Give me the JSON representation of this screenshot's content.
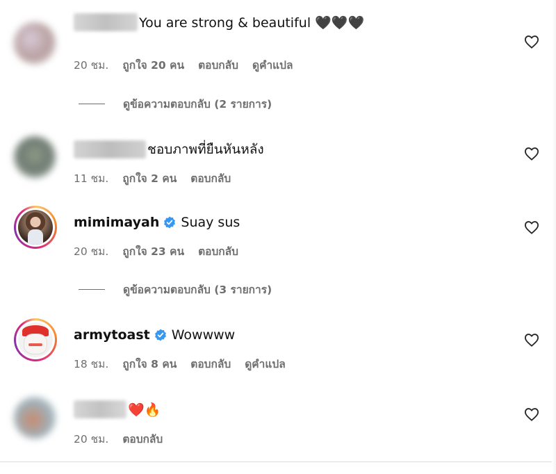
{
  "comments": [
    {
      "username": "",
      "text": "You are strong & beautiful 🖤🖤🖤",
      "time": "20 ชม.",
      "likes": "ถูกใจ 20 คน",
      "reply_label": "ตอบกลับ",
      "translate_label": "ดูคำแปล",
      "view_replies": "ดูข้อความตอบกลับ (2 รายการ)"
    },
    {
      "username": "",
      "text": "ชอบภาพที่ยืนหันหลัง",
      "time": "11 ชม.",
      "likes": "ถูกใจ 2 คน",
      "reply_label": "ตอบกลับ"
    },
    {
      "username": "mimimayah",
      "verified": true,
      "text": "Suay sus",
      "time": "20 ชม.",
      "likes": "ถูกใจ 23 คน",
      "reply_label": "ตอบกลับ",
      "view_replies": "ดูข้อความตอบกลับ (3 รายการ)"
    },
    {
      "username": "armytoast",
      "verified": true,
      "text": "Wowwww",
      "time": "18 ชม.",
      "likes": "ถูกใจ 8 คน",
      "reply_label": "ตอบกลับ",
      "translate_label": "ดูคำแปล"
    },
    {
      "username": "",
      "text": "❤️🔥",
      "time": "20 ชม.",
      "reply_label": "ตอบกลับ"
    }
  ],
  "colors": {
    "verified_badge": "#3897f0",
    "meta_text": "#6e6e6e",
    "story_ring_start": "#fdc468",
    "story_ring_end": "#8134af"
  },
  "icons": {
    "like": "heart-outline-icon",
    "verified": "verified-badge-icon"
  }
}
